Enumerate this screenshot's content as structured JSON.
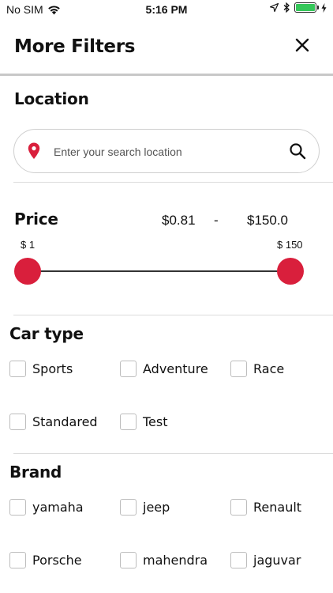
{
  "status_bar": {
    "carrier": "No SIM",
    "time": "5:16 PM"
  },
  "header": {
    "title": "More Filters",
    "close_icon": "close-icon"
  },
  "location": {
    "title": "Location",
    "placeholder": "Enter your search location",
    "value": "",
    "accent_color": "#d91f3c"
  },
  "price": {
    "title": "Price",
    "min_value": "$0.81",
    "separator": "-",
    "max_value": "$150.0",
    "range_min_label": "$ 1",
    "range_max_label": "$ 150",
    "thumb_color": "#d91f3c"
  },
  "car_type": {
    "title": "Car type",
    "options": [
      "Sports",
      "Adventure",
      "Race",
      "Standared",
      "Test"
    ]
  },
  "brand": {
    "title": "Brand",
    "options": [
      "yamaha",
      "jeep",
      "Renault",
      "Porsche",
      "mahendra",
      "jaguvar"
    ]
  }
}
